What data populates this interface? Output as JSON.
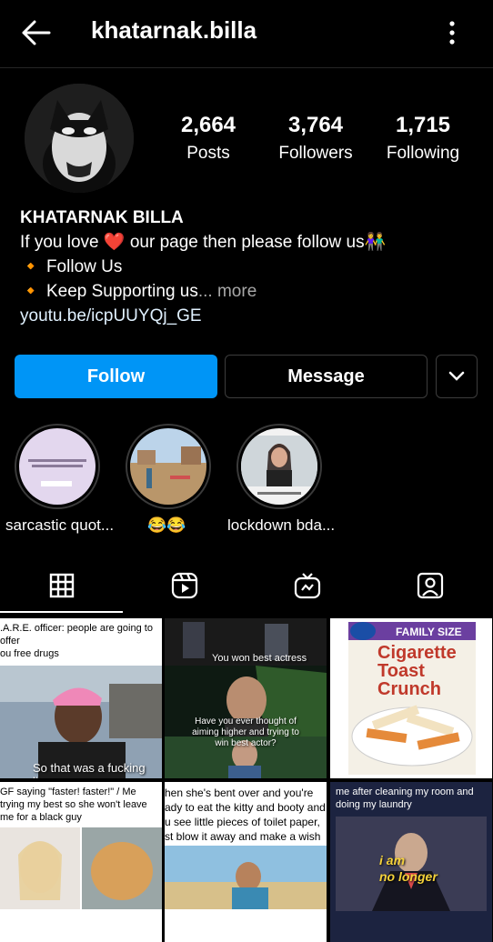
{
  "header": {
    "username": "khatarnak.billa"
  },
  "stats": [
    {
      "value": "2,664",
      "label": "Posts"
    },
    {
      "value": "3,764",
      "label": "Followers"
    },
    {
      "value": "1,715",
      "label": "Following"
    }
  ],
  "bio": {
    "name": "KHATARNAK BILLA",
    "line1_a": "If you love",
    "heart": "❤️",
    "line1_b": "our page then please follow us",
    "couple": "👫",
    "bullet": "🔸",
    "line2": "Follow Us",
    "line3": "Keep Supporting us",
    "more": "... more",
    "link": "youtu.be/icpUUYQj_GE"
  },
  "actions": {
    "follow": "Follow",
    "message": "Message"
  },
  "highlights": [
    {
      "label": "sarcastic quot..."
    },
    {
      "label": "😂😂"
    },
    {
      "label": "lockdown bda..."
    }
  ],
  "posts": {
    "p1": {
      "top": ".A.R.E. officer: people are going to offer\nou free drugs\n\nadult me:",
      "caption": "So that was a fucking lie."
    },
    "p2": {
      "caption_top": "You won best actress",
      "caption_bottom": "Have you ever thought of aiming higher and trying to win best actor?"
    },
    "p3": {
      "box_top": "FAMILY SIZE",
      "title1": "Cigarette",
      "title2": "Toast",
      "title3": "Crunch"
    },
    "p4": {
      "top": "GF saying \"faster! faster!\" / Me trying my best so she won't leave me for a black guy"
    },
    "p5": {
      "top": "hen she's bent over and you're ady to eat the kitty and booty and u see little pieces of toilet paper, st blow it away and make a wish"
    },
    "p6": {
      "top": "me after cleaning my room and doing my laundry",
      "caption1": "i am",
      "caption2": "no longer"
    }
  }
}
